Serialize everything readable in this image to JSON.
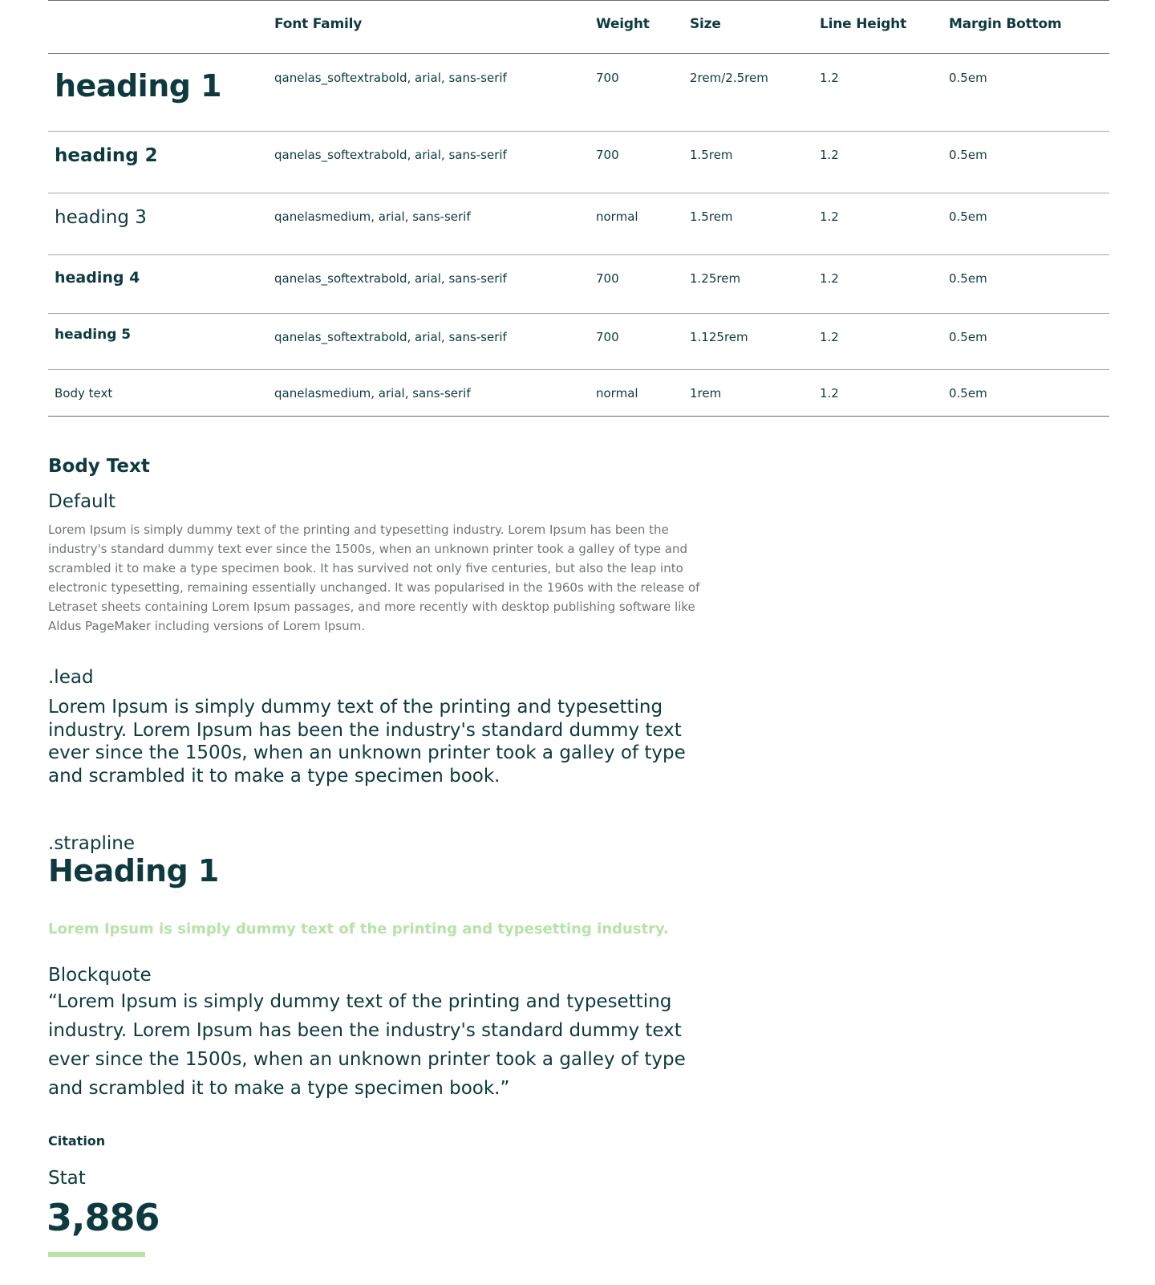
{
  "table": {
    "headers": [
      "",
      "Font Family",
      "Weight",
      "Size",
      "Line Height",
      "Margin Bottom"
    ],
    "rows": [
      {
        "sample": "heading 1",
        "family": "qanelas_softextrabold, arial, sans-serif",
        "weight": "700",
        "size": "2rem/2.5rem",
        "line_height": "1.2",
        "margin_bottom": "0.5em"
      },
      {
        "sample": "heading 2",
        "family": "qanelas_softextrabold, arial, sans-serif",
        "weight": "700",
        "size": "1.5rem",
        "line_height": "1.2",
        "margin_bottom": "0.5em"
      },
      {
        "sample": "heading 3",
        "family": "qanelasmedium, arial, sans-serif",
        "weight": "normal",
        "size": "1.5rem",
        "line_height": "1.2",
        "margin_bottom": "0.5em"
      },
      {
        "sample": "heading 4",
        "family": "qanelas_softextrabold, arial, sans-serif",
        "weight": "700",
        "size": "1.25rem",
        "line_height": "1.2",
        "margin_bottom": "0.5em"
      },
      {
        "sample": "heading 5",
        "family": "qanelas_softextrabold, arial, sans-serif",
        "weight": "700",
        "size": "1.125rem",
        "line_height": "1.2",
        "margin_bottom": "0.5em"
      },
      {
        "sample": "Body text",
        "family": "qanelasmedium, arial, sans-serif",
        "weight": "normal",
        "size": "1rem",
        "line_height": "1.2",
        "margin_bottom": "0.5em"
      }
    ]
  },
  "body_text": {
    "title": "Body Text",
    "default_label": "Default",
    "default_paragraph": "Lorem Ipsum is simply dummy text of the printing and typesetting industry. Lorem Ipsum has been the industry's standard dummy text ever since the 1500s, when an unknown printer took a galley of type and scrambled it to make a type specimen book. It has survived not only five centuries, but also the leap into electronic typesetting, remaining essentially unchanged. It was popularised in the 1960s with the release of Letraset sheets containing Lorem Ipsum passages, and more recently with desktop publishing software like Aldus PageMaker including versions of Lorem Ipsum.",
    "lead_label": ".lead",
    "lead_paragraph": "Lorem Ipsum is simply dummy text of the printing and typesetting industry. Lorem Ipsum has been the industry's standard dummy text ever since the 1500s, when an unknown printer took a galley of type and scrambled it to make a type specimen book.",
    "strapline_label": ".strapline",
    "strapline_heading": "Heading 1",
    "strapline_text": "Lorem Ipsum is simply dummy text of the printing and typesetting industry.",
    "blockquote_label": "Blockquote",
    "blockquote_text": "“Lorem Ipsum is simply dummy text of the printing and typesetting industry. Lorem Ipsum has been the industry's standard dummy text ever since the 1500s, when an unknown printer took a galley of type and scrambled it to make a type specimen book.”",
    "citation": "Citation",
    "stat_label": "Stat",
    "stat_value": "3,886"
  },
  "colors": {
    "primary": "#0e3a3f",
    "muted_text": "#6f7475",
    "accent_green": "#b7e2a8",
    "rule": "#6b6b6b"
  }
}
